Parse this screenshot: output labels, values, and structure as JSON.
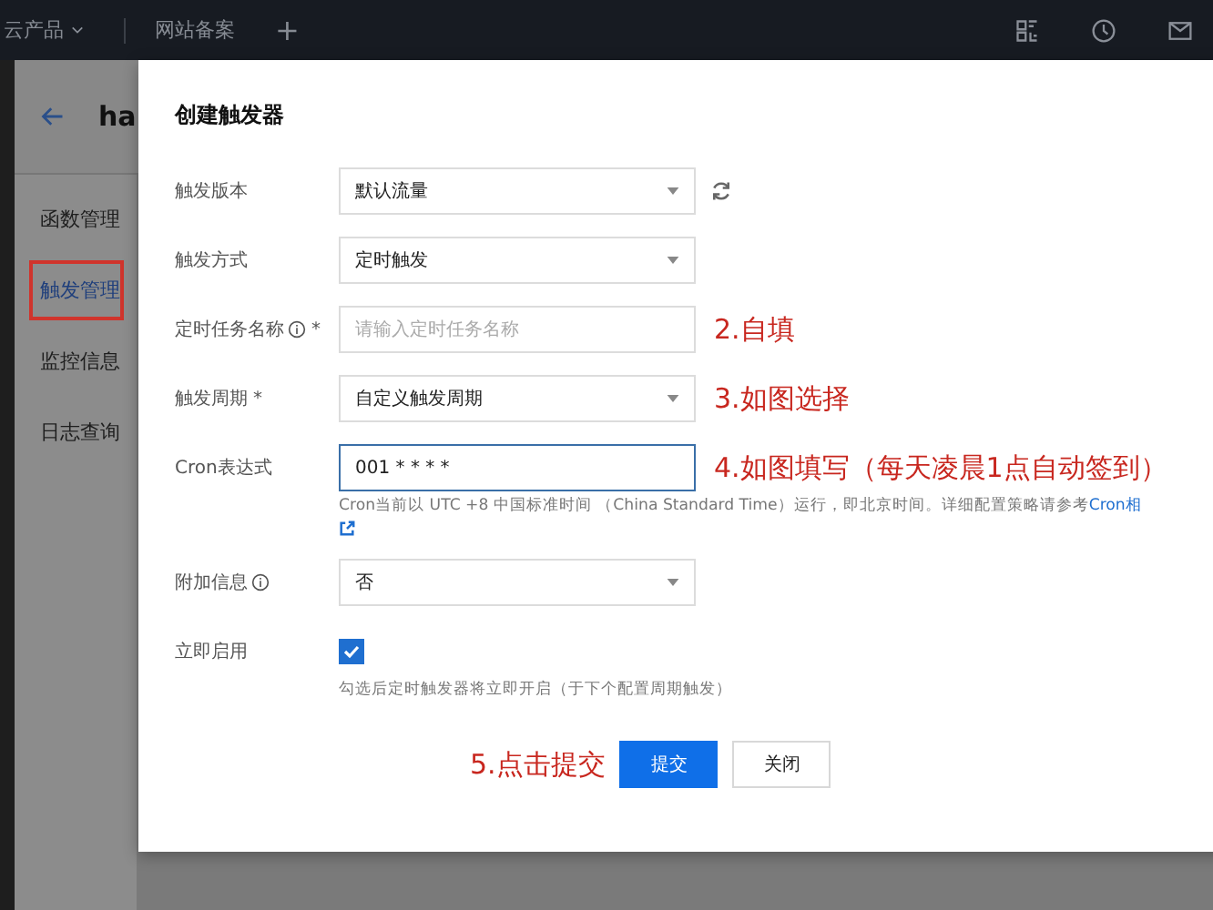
{
  "topbar": {
    "items": [
      {
        "label": "云产品",
        "dropdown": true
      },
      {
        "label": "网站备案",
        "dropdown": false
      }
    ],
    "add": "+"
  },
  "page": {
    "title": "ha"
  },
  "sidebar": {
    "items": [
      {
        "label": "函数管理",
        "selected": false
      },
      {
        "label": "触发管理",
        "selected": true
      },
      {
        "label": "监控信息",
        "selected": false
      },
      {
        "label": "日志查询",
        "selected": false
      }
    ]
  },
  "dialog": {
    "title": "创建触发器",
    "fields": [
      {
        "kind": "select",
        "label": "触发版本",
        "value": "默认流量",
        "refresh": true
      },
      {
        "kind": "select",
        "label": "触发方式",
        "value": "定时触发"
      },
      {
        "kind": "input",
        "label": "定时任务名称",
        "info": true,
        "mark": "*",
        "placeholder": "请输入定时任务名称",
        "note": "2.自填"
      },
      {
        "kind": "select",
        "label": "触发周期",
        "mark": "*",
        "value": "自定义触发周期",
        "note": "3.如图选择"
      },
      {
        "kind": "input",
        "label": "Cron表达式",
        "value": "001 * * * *",
        "focused": true,
        "note": "4.如图填写（每天凌晨1点自动签到）",
        "help": "Cron当前以 UTC +8 中国标准时间 （China Standard Time）运行，即北京时间。详细配置策略请参考",
        "help_link": "Cron相"
      },
      {
        "kind": "select",
        "label": "附加信息",
        "info": true,
        "value": "否"
      },
      {
        "kind": "checkbox",
        "label": "立即启用",
        "checked": true,
        "help": "勾选后定时触发器将立即开启（于下个配置周期触发）"
      }
    ],
    "note": "5.点击提交",
    "buttons": [
      {
        "label": "提交",
        "primary": true
      },
      {
        "label": "关闭",
        "primary": false
      }
    ]
  }
}
